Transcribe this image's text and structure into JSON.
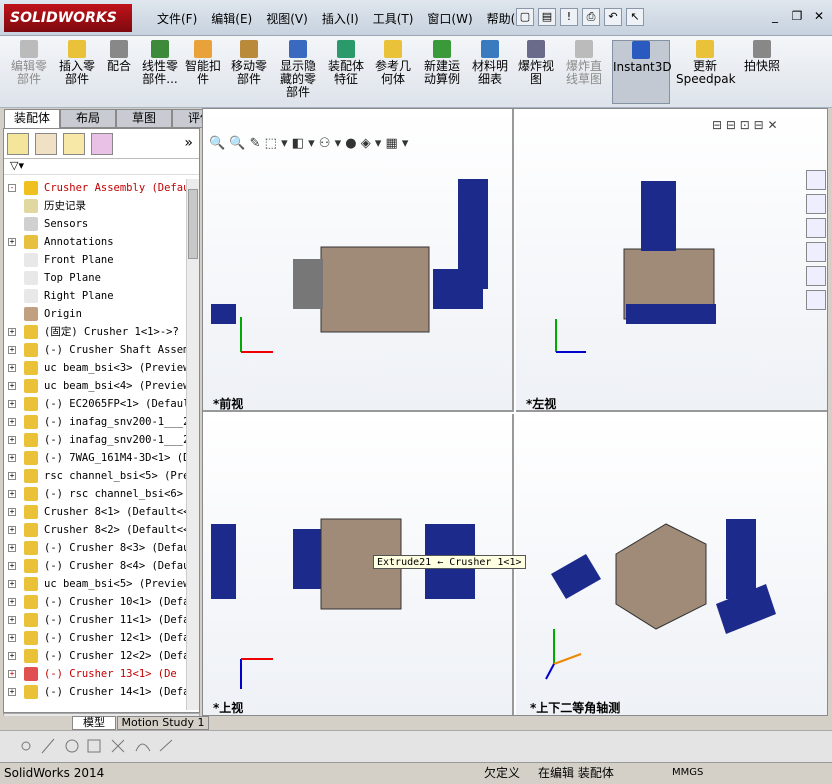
{
  "app": {
    "logo": "SOLIDWORKS",
    "status": "SolidWorks 2014"
  },
  "menu": [
    "文件(F)",
    "编辑(E)",
    "视图(V)",
    "插入(I)",
    "工具(T)",
    "窗口(W)",
    "帮助(H)"
  ],
  "ribbon": [
    {
      "label": "编辑零\n部件",
      "disabled": true
    },
    {
      "label": "插入零\n部件",
      "disabled": false
    },
    {
      "label": "配合",
      "disabled": false
    },
    {
      "label": "线性零\n部件...",
      "disabled": false
    },
    {
      "label": "智能扣\n件",
      "disabled": false
    },
    {
      "label": "移动零\n部件",
      "disabled": false
    },
    {
      "label": "显示隐\n藏的零\n部件",
      "disabled": false
    },
    {
      "label": "装配体\n特征",
      "disabled": false
    },
    {
      "label": "参考几\n何体",
      "disabled": false
    },
    {
      "label": "新建运\n动算例",
      "disabled": false
    },
    {
      "label": "材料明\n细表",
      "disabled": false
    },
    {
      "label": "爆炸视\n图",
      "disabled": false
    },
    {
      "label": "爆炸直\n线草图",
      "disabled": true
    },
    {
      "label": "Instant3D",
      "disabled": false
    },
    {
      "label": "更新\nSpeedpak",
      "disabled": false
    },
    {
      "label": "拍快照",
      "disabled": false
    }
  ],
  "tabs": [
    "装配体",
    "布局",
    "草图",
    "评估"
  ],
  "tree": [
    {
      "label": "Crusher Assembly  (Defau",
      "red": true,
      "exp": "-"
    },
    {
      "label": "历史记录",
      "red": false,
      "exp": ""
    },
    {
      "label": "Sensors",
      "red": false,
      "exp": ""
    },
    {
      "label": "Annotations",
      "red": false,
      "exp": "+"
    },
    {
      "label": "Front Plane",
      "red": false,
      "exp": ""
    },
    {
      "label": "Top Plane",
      "red": false,
      "exp": ""
    },
    {
      "label": "Right Plane",
      "red": false,
      "exp": ""
    },
    {
      "label": "Origin",
      "red": false,
      "exp": ""
    },
    {
      "label": "(固定) Crusher 1<1>->?",
      "red": false,
      "exp": "+"
    },
    {
      "label": "(-) Crusher Shaft Assem",
      "red": false,
      "exp": "+"
    },
    {
      "label": "uc beam_bsi<3> (Preview(",
      "red": false,
      "exp": "+"
    },
    {
      "label": "uc beam_bsi<4> (Preview(",
      "red": false,
      "exp": "+"
    },
    {
      "label": "(-) EC2065FP<1> (Default-",
      "red": false,
      "exp": "+"
    },
    {
      "label": "(-) inafag_snv200-1___20",
      "red": false,
      "exp": "+"
    },
    {
      "label": "(-) inafag_snv200-1___20",
      "red": false,
      "exp": "+"
    },
    {
      "label": "(-) 7WAG_161M4-3D<1> (D",
      "red": false,
      "exp": "+"
    },
    {
      "label": "rsc channel_bsi<5> (Prev",
      "red": false,
      "exp": "+"
    },
    {
      "label": "(-) rsc channel_bsi<6>",
      "red": false,
      "exp": "+"
    },
    {
      "label": "Crusher 8<1> (Default<<",
      "red": false,
      "exp": "+"
    },
    {
      "label": "Crusher 8<2> (Default<<D",
      "red": false,
      "exp": "+"
    },
    {
      "label": "(-) Crusher 8<3> (Defau",
      "red": false,
      "exp": "+"
    },
    {
      "label": "(-) Crusher 8<4> (Defau",
      "red": false,
      "exp": "+"
    },
    {
      "label": "uc beam_bsi<5> (Preview(",
      "red": false,
      "exp": "+"
    },
    {
      "label": "(-) Crusher 10<1> (Defa",
      "red": false,
      "exp": "+"
    },
    {
      "label": "(-) Crusher 11<1> (Defa",
      "red": false,
      "exp": "+"
    },
    {
      "label": "(-) Crusher 12<1> (Defa",
      "red": false,
      "exp": "+"
    },
    {
      "label": "(-) Crusher 12<2> (Defa",
      "red": false,
      "exp": "+"
    },
    {
      "label": "(-) Crusher 13<1> (De",
      "red": true,
      "exp": "+"
    },
    {
      "label": "(-) Crusher 14<1> (Defa",
      "red": false,
      "exp": "+"
    }
  ],
  "views": {
    "front": "*前视",
    "left": "*左视",
    "top": "*上视",
    "iso": "*上下二等角轴测"
  },
  "tooltip": "Extrude21 ← Crusher 1<1>",
  "bottom_tabs": [
    "模型",
    "Motion Study 1"
  ],
  "status": {
    "s1": "欠定义",
    "s2": "在编辑 装配体",
    "s3": "MMGS"
  },
  "colors": {
    "blue": "#1c2a8c",
    "frame": "#8a7a6a"
  }
}
